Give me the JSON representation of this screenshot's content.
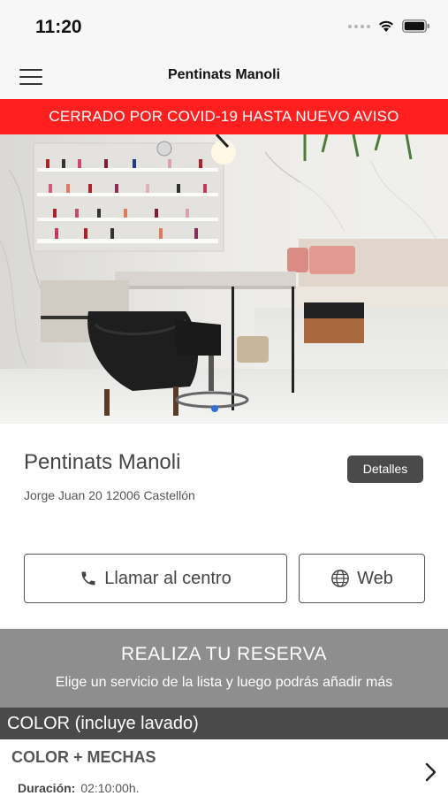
{
  "status_bar": {
    "time": "11:20",
    "icons": [
      "signal-icon",
      "wifi-icon",
      "battery-icon"
    ]
  },
  "nav": {
    "title": "Pentinats Manoli",
    "menu_icon": "hamburger-menu-icon"
  },
  "banner": {
    "text": "CERRADO POR COVID-19 HASTA NUEVO AVISO",
    "color": "#ff1f1f"
  },
  "hero": {
    "carousel_pages": 1,
    "active_page": 1
  },
  "salon": {
    "name": "Pentinats Manoli",
    "address": "Jorge Juan 20 12006 Castellón",
    "details_label": "Detalles"
  },
  "actions": {
    "call_label": "Llamar al centro",
    "call_icon": "phone-icon",
    "web_label": "Web",
    "web_icon": "globe-icon"
  },
  "booking": {
    "title": "REALIZA TU RESERVA",
    "subtitle": "Elige un servicio de la lista y luego podrás añadir más"
  },
  "services": {
    "category": "COLOR (incluye lavado)",
    "items": [
      {
        "name": "COLOR + MECHAS",
        "duration_label": "Duración:",
        "duration": "02:10:00h."
      }
    ]
  },
  "colors": {
    "category_bg": "#4a4a4a",
    "booking_bg": "#8e8e8e",
    "details_bg": "#4a4a4a"
  }
}
